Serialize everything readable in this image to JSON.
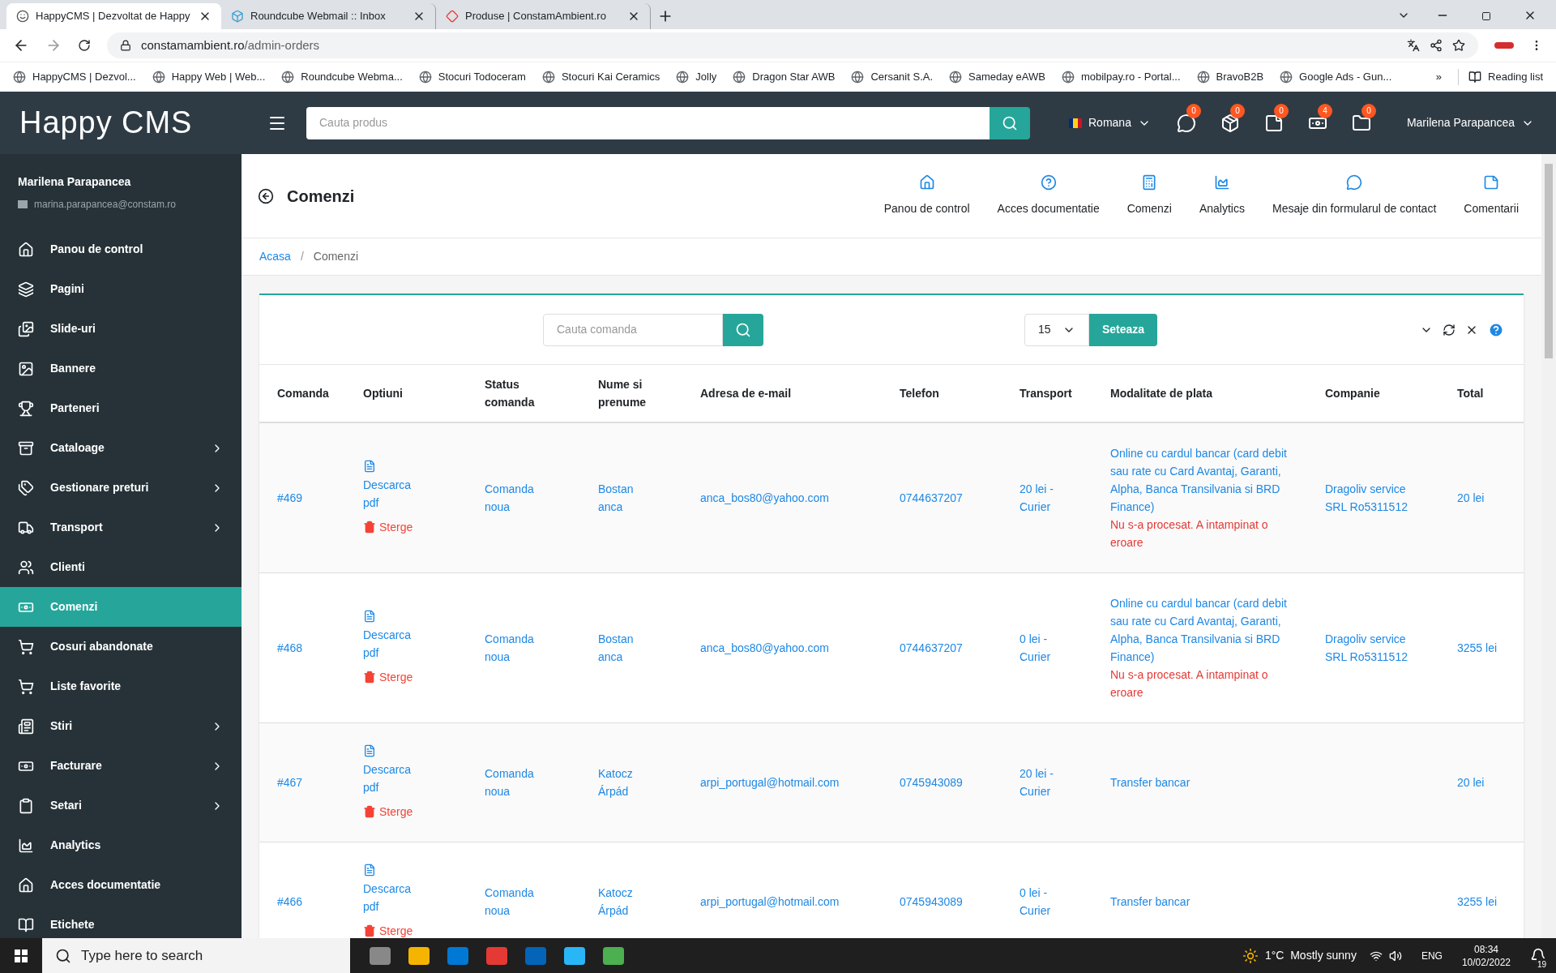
{
  "browser": {
    "tabs": [
      {
        "title": "HappyCMS | Dezvoltat de Happy",
        "selected": true
      },
      {
        "title": "Roundcube Webmail :: Inbox",
        "selected": false
      },
      {
        "title": "Produse | ConstamAmbient.ro",
        "selected": false
      }
    ],
    "url_host": "constamambient.ro",
    "url_path": "/admin-orders",
    "bookmarks": [
      "HappyCMS | Dezvol...",
      "Happy Web | Web...",
      "Roundcube Webma...",
      "Stocuri Todoceram",
      "Stocuri Kai Ceramics",
      "Jolly",
      "Dragon Star AWB",
      "Cersanit S.A.",
      "Sameday eAWB",
      "mobilpay.ro - Portal...",
      "BravoB2B",
      "Google Ads - Gun..."
    ],
    "more": "»",
    "reading_list": "Reading list"
  },
  "header": {
    "logo": "Happy CMS",
    "search_placeholder": "Cauta produs",
    "language": "Romana",
    "badges": [
      "0",
      "0",
      "0",
      "4",
      "0"
    ],
    "user": "Marilena Parapancea"
  },
  "sidebar": {
    "user_name": "Marilena Parapancea",
    "user_email": "marina.parapancea@constam.ro",
    "items": [
      {
        "label": "Panou de control",
        "has_children": false,
        "selected": false
      },
      {
        "label": "Pagini",
        "has_children": false,
        "selected": false
      },
      {
        "label": "Slide-uri",
        "has_children": false,
        "selected": false
      },
      {
        "label": "Bannere",
        "has_children": false,
        "selected": false
      },
      {
        "label": "Parteneri",
        "has_children": false,
        "selected": false
      },
      {
        "label": "Cataloage",
        "has_children": true,
        "selected": false
      },
      {
        "label": "Gestionare preturi",
        "has_children": true,
        "selected": false
      },
      {
        "label": "Transport",
        "has_children": true,
        "selected": false
      },
      {
        "label": "Clienti",
        "has_children": false,
        "selected": false
      },
      {
        "label": "Comenzi",
        "has_children": false,
        "selected": true
      },
      {
        "label": "Cosuri abandonate",
        "has_children": false,
        "selected": false
      },
      {
        "label": "Liste favorite",
        "has_children": false,
        "selected": false
      },
      {
        "label": "Stiri",
        "has_children": true,
        "selected": false
      },
      {
        "label": "Facturare",
        "has_children": true,
        "selected": false
      },
      {
        "label": "Setari",
        "has_children": true,
        "selected": false
      },
      {
        "label": "Analytics",
        "has_children": false,
        "selected": false
      },
      {
        "label": "Acces documentatie",
        "has_children": false,
        "selected": false
      },
      {
        "label": "Etichete",
        "has_children": false,
        "selected": false
      }
    ]
  },
  "page": {
    "title": "Comenzi",
    "shortcuts": [
      "Panou de control",
      "Acces documentatie",
      "Comenzi",
      "Analytics",
      "Mesaje din formularul de contact",
      "Comentarii"
    ],
    "breadcrumb": {
      "items": [
        "Acasa",
        "Comenzi"
      ],
      "separator": "/"
    }
  },
  "toolbar": {
    "search_placeholder": "Cauta comanda",
    "per_page": "15",
    "set_button": "Seteaza"
  },
  "table": {
    "columns": [
      "Comanda",
      "Optiuni",
      "Status comanda",
      "Nume si prenume",
      "Adresa de e-mail",
      "Telefon",
      "Transport",
      "Modalitate de plata",
      "Companie",
      "Total"
    ],
    "rows": [
      {
        "order": "#469",
        "download_label": "Descarca pdf",
        "delete_label": "Sterge",
        "status": "Comanda noua",
        "name": "Bostan anca",
        "email": "anca_bos80@yahoo.com",
        "phone": "0744637207",
        "transport": "20 lei - Curier",
        "payment": "Online cu cardul bancar (card debit sau rate cu Card Avantaj, Garanti, Alpha, Banca Transilvania si BRD Finance)",
        "payment_error": "Nu s-a procesat. A intampinat o eroare",
        "company": "Dragoliv service SRL Ro5311512",
        "total": "20 lei"
      },
      {
        "order": "#468",
        "download_label": "Descarca pdf",
        "delete_label": "Sterge",
        "status": "Comanda noua",
        "name": "Bostan anca",
        "email": "anca_bos80@yahoo.com",
        "phone": "0744637207",
        "transport": "0 lei - Curier",
        "payment": "Online cu cardul bancar (card debit sau rate cu Card Avantaj, Garanti, Alpha, Banca Transilvania si BRD Finance)",
        "payment_error": "Nu s-a procesat. A intampinat o eroare",
        "company": "Dragoliv service SRL Ro5311512",
        "total": "3255 lei"
      },
      {
        "order": "#467",
        "download_label": "Descarca pdf",
        "delete_label": "Sterge",
        "status": "Comanda noua",
        "name": "Katocz Árpád",
        "email": "arpi_portugal@hotmail.com",
        "phone": "0745943089",
        "transport": "20 lei - Curier",
        "payment": "Transfer bancar",
        "total": "20 lei"
      },
      {
        "order": "#466",
        "download_label": "Descarca pdf",
        "delete_label": "Sterge",
        "status": "Comanda noua",
        "name": "Katocz Árpád",
        "email": "arpi_portugal@hotmail.com",
        "phone": "0745943089",
        "transport": "0 lei - Curier",
        "payment": "Transfer bancar",
        "total": "3255 lei"
      }
    ]
  },
  "taskbar": {
    "search_placeholder": "Type here to search",
    "weather": "1°C  Mostly sunny",
    "language": "ENG",
    "time": "08:34",
    "date": "10/02/2022",
    "notifications": "19"
  }
}
